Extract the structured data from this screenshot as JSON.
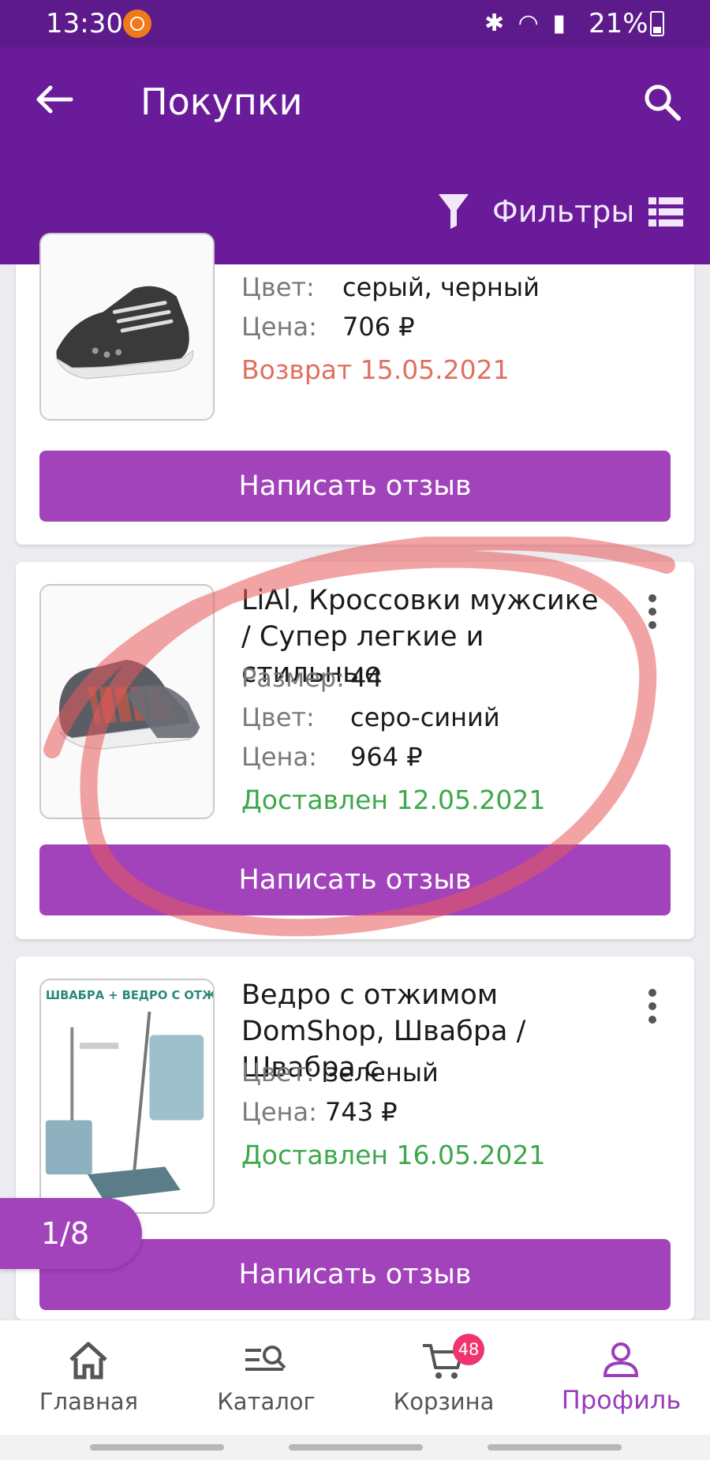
{
  "status_bar": {
    "time": "13:30",
    "battery": "21%"
  },
  "app_bar": {
    "title": "Покупки",
    "filters_label": "Фильтры"
  },
  "orders": [
    {
      "rows": [
        {
          "key": "Цвет:",
          "value": "серый, черный"
        },
        {
          "key": "Цена:",
          "value": "706 ₽"
        }
      ],
      "status": "Возврат 15.05.2021",
      "review_button": "Написать отзыв"
    },
    {
      "title": "LiAl, Кроссовки мужсике / Супер легкие и стильные",
      "rows": [
        {
          "key": "Размер:",
          "value": "44"
        },
        {
          "key": "Цвет:",
          "value": "серо-синий"
        },
        {
          "key": "Цена:",
          "value": "964 ₽"
        }
      ],
      "status": "Доставлен 12.05.2021",
      "review_button": "Написать отзыв"
    },
    {
      "title": "Ведро с отжимом DomShop, Швабра / Швабра с",
      "image_text": "ШВАБРА + ВЕДРО С ОТЖИМОМ",
      "rows": [
        {
          "key": "Цвет:",
          "value": "зеленый"
        },
        {
          "key": "Цена:",
          "value": "743 ₽"
        }
      ],
      "status": "Доставлен 16.05.2021",
      "review_button": "Написать отзыв"
    }
  ],
  "page_indicator": "1/8",
  "bottom_nav": [
    {
      "label": "Главная",
      "icon": "home-icon"
    },
    {
      "label": "Каталог",
      "icon": "catalog-search-icon"
    },
    {
      "label": "Корзина",
      "icon": "cart-icon",
      "badge": "48"
    },
    {
      "label": "Профиль",
      "icon": "profile-icon",
      "active": true
    }
  ],
  "colors": {
    "status_bar": "#5c1a8a",
    "app_bar": "#6a1b9a",
    "accent_button": "#a243bc",
    "returned": "#e07060",
    "delivered": "#3da84b",
    "badge": "#f0356e"
  }
}
